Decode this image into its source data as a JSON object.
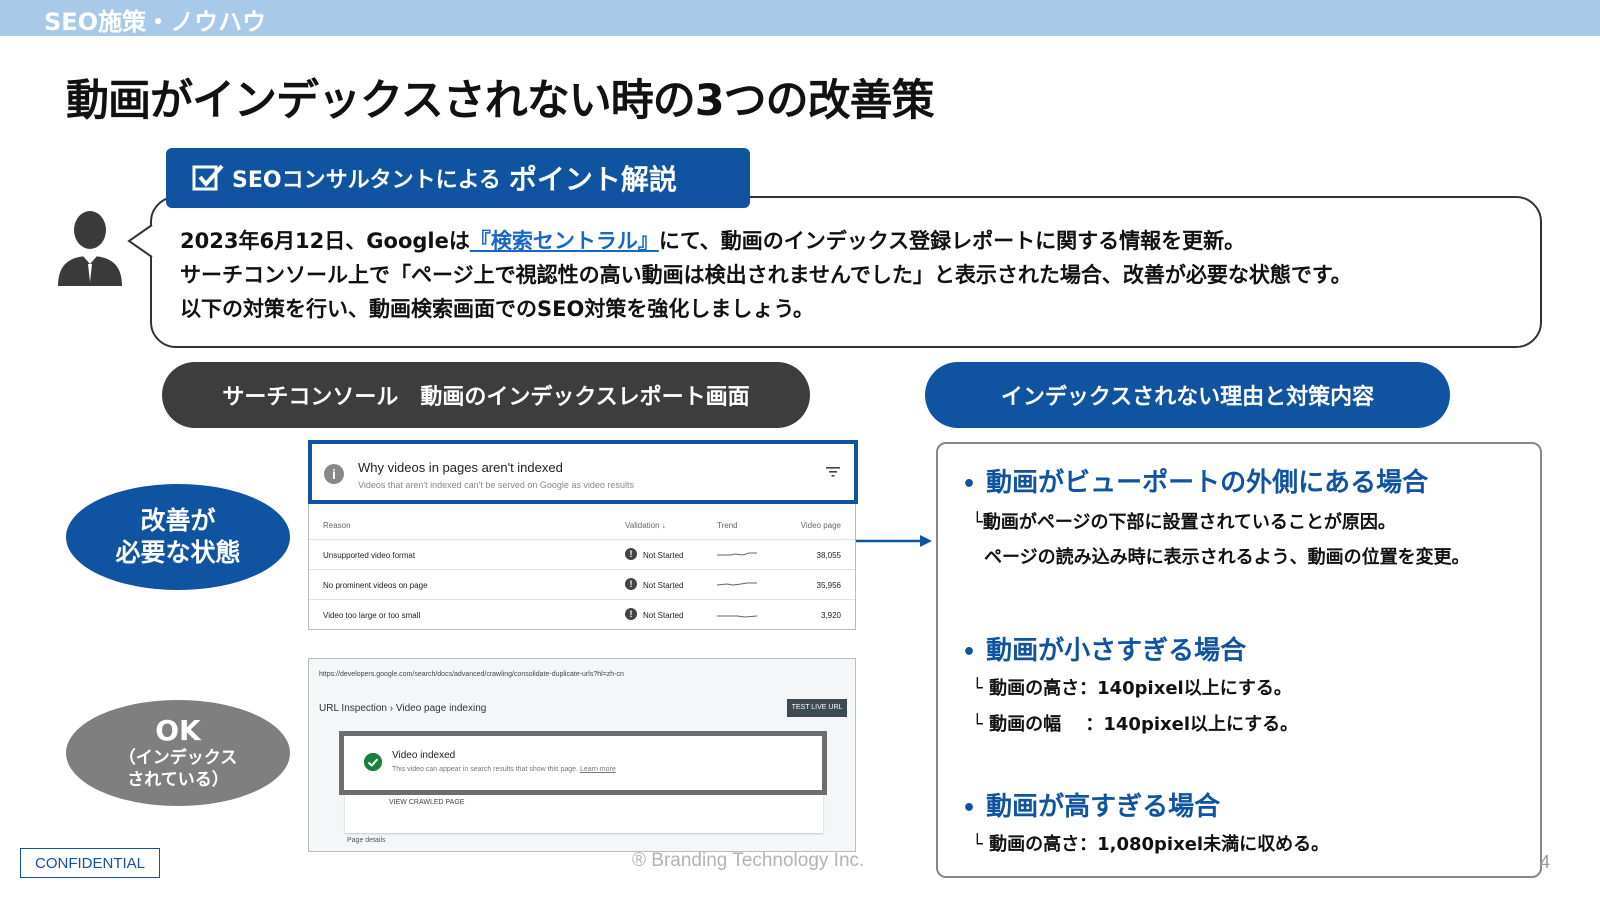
{
  "header": {
    "category": "SEO施策・ノウハウ"
  },
  "title": "動画がインデックスされない時の3つの改善策",
  "consultant": {
    "badge_small": "SEOコンサルタントによる",
    "badge_big": "ポイント解説",
    "line1_pre": "2023年6月12日、Googleは",
    "line1_link": "『検索セントラル』",
    "line1_post": "にて、動画のインデックス登録レポートに関する情報を更新。",
    "line2": "サーチコンソール上で「ページ上で視認性の高い動画は検出されませんでした」と表示された場合、改善が必要な状態です。",
    "line3": "以下の対策を行い、動画検索画面でのSEO対策を強化しましょう。"
  },
  "left_heading": "サーチコンソール　動画のインデックスレポート画面",
  "right_heading": "インデックスされない理由と対策内容",
  "status_bad": {
    "line1": "改善が",
    "line2": "必要な状態"
  },
  "status_ok": {
    "line1": "OK",
    "line2": "（インデックス",
    "line3": "されている）"
  },
  "report": {
    "title": "Why videos in pages aren't indexed",
    "subtitle": "Videos that aren't indexed can't be served on Google as video results",
    "columns": {
      "reason": "Reason",
      "validation": "Validation ↓",
      "trend": "Trend",
      "pages": "Video page"
    },
    "rows": [
      {
        "reason": "Unsupported video format",
        "validation": "Not Started",
        "pages": "38,055"
      },
      {
        "reason": "No prominent videos on page",
        "validation": "Not Started",
        "pages": "35,956"
      },
      {
        "reason": "Video too large or too small",
        "validation": "Not Started",
        "pages": "3,920"
      }
    ]
  },
  "inspection": {
    "url": "https://developers.google.com/search/docs/advanced/crawling/consolidate-duplicate-urls?hl=zh-cn",
    "breadcrumb": "URL Inspection  ›  Video page indexing",
    "test_button": "TEST LIVE URL",
    "status_title": "Video indexed",
    "status_sub": "This video can appear in search results that show this page.",
    "learn_more": "Learn more",
    "view_crawled": "VIEW CRAWLED PAGE",
    "page_details": "Page details"
  },
  "measures": [
    {
      "heading": "動画がビューポートの外側にある場合",
      "lines": [
        "└動画がページの下部に設置されていることが原因。",
        "ページの読み込み時に表示されるよう、動画の位置を変更。"
      ]
    },
    {
      "heading": "動画が小さすぎる場合",
      "lines": [
        "└ 動画の高さ：140pixel以上にする。",
        "└ 動画の幅　 ：140pixel以上にする。"
      ]
    },
    {
      "heading": "動画が高すぎる場合",
      "lines": [
        "└ 動画の高さ：1,080pixel未満に収める。"
      ]
    }
  ],
  "footer": {
    "confidential": "CONFIDENTIAL",
    "copyright": "® Branding Technology Inc.",
    "page": "4"
  },
  "colors": {
    "brand_blue": "#1053a1",
    "top_bar": "#a8c9e8",
    "dark_pill": "#3d3d3d",
    "ok_gray": "#7f7f7f",
    "link": "#1667c8"
  },
  "icons": [
    "checkbox-icon",
    "consultant-avatar-icon",
    "info-icon",
    "filter-icon",
    "alert-icon",
    "check-circle-icon",
    "arrow-right-icon"
  ]
}
